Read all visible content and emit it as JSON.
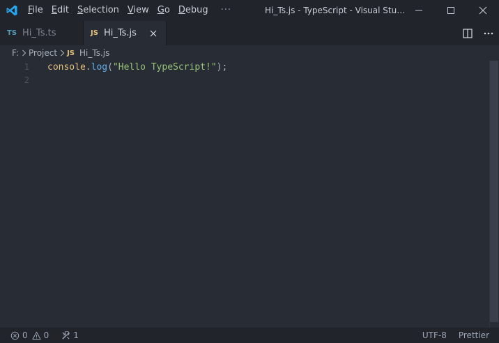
{
  "titlebar": {
    "app_icon": "vscode-logo",
    "menu": [
      {
        "label": "File",
        "mnemonic": "F",
        "rest": "ile"
      },
      {
        "label": "Edit",
        "mnemonic": "E",
        "rest": "dit"
      },
      {
        "label": "Selection",
        "mnemonic": "S",
        "rest": "election"
      },
      {
        "label": "View",
        "mnemonic": "V",
        "rest": "iew"
      },
      {
        "label": "Go",
        "mnemonic": "G",
        "rest": "o"
      },
      {
        "label": "Debug",
        "mnemonic": "D",
        "rest": "ebug"
      }
    ],
    "more": "···",
    "window_title": "Hi_Ts.js - TypeScript - Visual Stud...",
    "controls": [
      "minimize-icon",
      "maximize-icon",
      "close-icon"
    ]
  },
  "tabs": [
    {
      "badge": "TS",
      "label": "Hi_Ts.ts",
      "active": false
    },
    {
      "badge": "JS",
      "label": "Hi_Ts.js",
      "active": true
    }
  ],
  "tab_actions": [
    "split-editor-icon",
    "more-actions-icon"
  ],
  "breadcrumb": {
    "drive": "F:",
    "folder": "Project",
    "file_badge": "JS",
    "file": "Hi_Ts.js"
  },
  "editor": {
    "line_numbers": [
      "1",
      "2"
    ],
    "line1": {
      "object": "console",
      "dot": ".",
      "method": "log",
      "open": "(",
      "string": "\"Hello TypeScript!\"",
      "close": ");"
    },
    "line2": ""
  },
  "statusbar": {
    "errors": "0",
    "warnings": "0",
    "tools_count": "1",
    "encoding": "UTF-8",
    "formatter": "Prettier"
  },
  "colors": {
    "background": "#282c34",
    "chrome": "#21252b",
    "accent_ts": "#519aba",
    "accent_js": "#e5c07b",
    "vscode_blue": "#23a9f2"
  }
}
